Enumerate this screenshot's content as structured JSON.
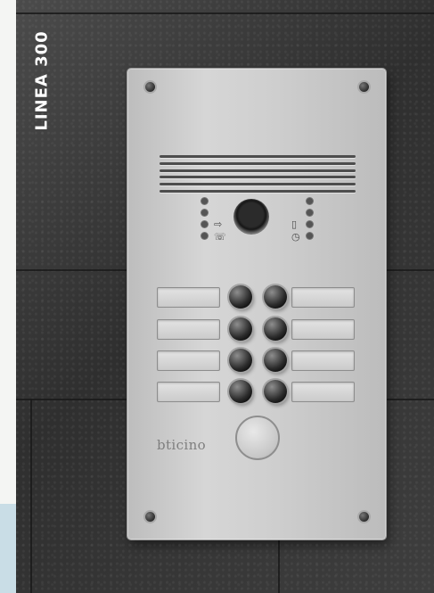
{
  "image": {
    "side_label": "LINEA 300",
    "panel": {
      "brand_logo": "bticino",
      "status_icons_left": [
        "door-open-icon",
        "phone-icon"
      ],
      "status_icons_right": [
        "door-icon",
        "busy-icon"
      ],
      "call_buttons": [
        {
          "row": 1,
          "side": "left"
        },
        {
          "row": 1,
          "side": "right"
        },
        {
          "row": 2,
          "side": "left"
        },
        {
          "row": 2,
          "side": "right"
        },
        {
          "row": 3,
          "side": "left"
        },
        {
          "row": 3,
          "side": "right"
        },
        {
          "row": 4,
          "side": "left"
        },
        {
          "row": 4,
          "side": "right"
        }
      ]
    }
  }
}
